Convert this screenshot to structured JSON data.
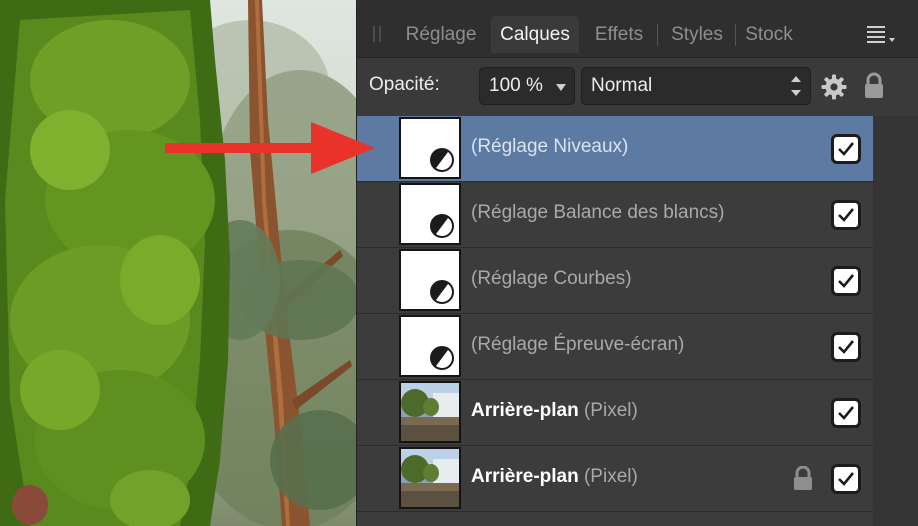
{
  "tabs": [
    {
      "label": "Réglage",
      "active": false
    },
    {
      "label": "Calques",
      "active": true
    },
    {
      "label": "Effets",
      "active": false
    },
    {
      "label": "Styles",
      "active": false
    },
    {
      "label": "Stock",
      "active": false
    }
  ],
  "options": {
    "opacity_label": "Opacité:",
    "opacity_value": "100 %",
    "blend_mode": "Normal"
  },
  "layers": [
    {
      "name": "(Réglage Niveaux)",
      "kind": "adjustment",
      "selected": true,
      "visible": true,
      "locked": false
    },
    {
      "name": "(Réglage Balance des blancs)",
      "kind": "adjustment",
      "selected": false,
      "visible": true,
      "locked": false
    },
    {
      "name": "(Réglage Courbes)",
      "kind": "adjustment",
      "selected": false,
      "visible": true,
      "locked": false
    },
    {
      "name": "(Réglage Épreuve-écran)",
      "kind": "adjustment",
      "selected": false,
      "visible": true,
      "locked": false
    },
    {
      "name": "Arrière-plan",
      "type": "(Pixel)",
      "kind": "pixel",
      "selected": false,
      "visible": true,
      "locked": false
    },
    {
      "name": "Arrière-plan",
      "type": "(Pixel)",
      "kind": "pixel",
      "selected": false,
      "visible": true,
      "locked": true
    }
  ],
  "icons": {
    "panel_menu": "hamburger-icon",
    "settings": "gear-icon",
    "lock": "lock-icon",
    "adjustment": "half-circle-adjustment-icon",
    "checkbox": "checkmark-icon",
    "annotation": "red-arrow-icon"
  },
  "colors": {
    "selection": "#5d7aa3",
    "annotation_arrow": "#e8322a",
    "panel_bg": "#3a3a3a"
  }
}
